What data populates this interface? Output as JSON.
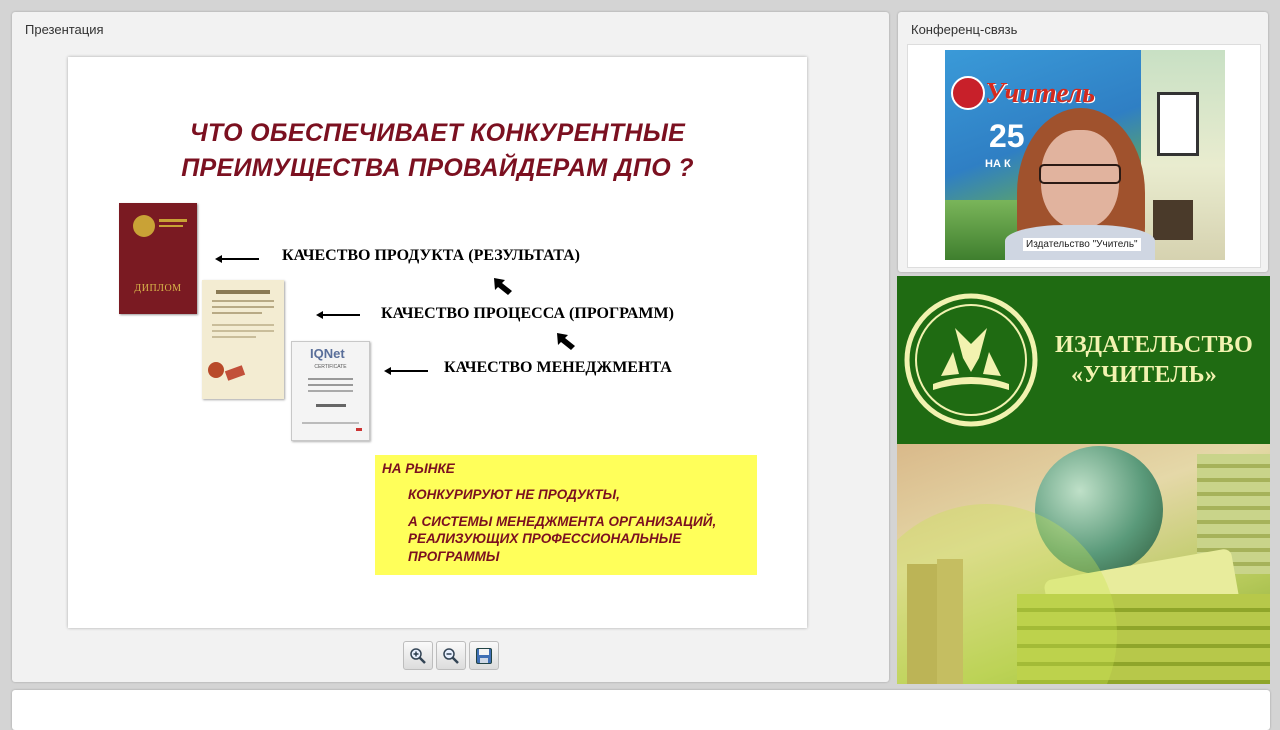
{
  "presentation": {
    "panel_title": "Презентация",
    "slide": {
      "title_line1": "ЧТО ОБЕСПЕЧИВАЕТ КОНКУРЕНТНЫЕ",
      "title_line2": "ПРЕИМУЩЕСТВА ПРОВАЙДЕРАМ ДПО ?",
      "rows": [
        "КАЧЕСТВО ПРОДУКТА (РЕЗУЛЬТАТА)",
        "КАЧЕСТВО ПРОЦЕССА (ПРОГРАММ)",
        "КАЧЕСТВО МЕНЕДЖМЕНТА"
      ],
      "diploma_label": "ДИПЛОМ",
      "certificate_label": "IQNet",
      "certificate_sub": "CERTIFICATE",
      "callout": {
        "line1": "НА РЫНКЕ",
        "line2": "КОНКУРИРУЮТ НЕ ПРОДУКТЫ,",
        "line3": "А СИСТЕМЫ МЕНЕДЖМЕНТА ОРГАНИЗАЦИЙ,",
        "line4": "РЕАЛИЗУЮЩИХ ПРОФЕССИОНАЛЬНЫЕ",
        "line5": "ПРОГРАММЫ"
      }
    },
    "toolbar": {
      "zoom_in_icon": "zoom-in-icon",
      "zoom_out_icon": "zoom-out-icon",
      "save_icon": "save-icon"
    }
  },
  "conference": {
    "panel_title": "Конференц-связь",
    "speaker_name": "Издательство \"Учитель\"",
    "poster_text": "Учитель",
    "poster_number": "25",
    "poster_sub": "НА К"
  },
  "banner": {
    "title_line1": "ИЗДАТЕЛЬСТВО",
    "title_line2": "«УЧИТЕЛЬ»",
    "green": "#1f6b12",
    "light": "#f2f2b0"
  }
}
